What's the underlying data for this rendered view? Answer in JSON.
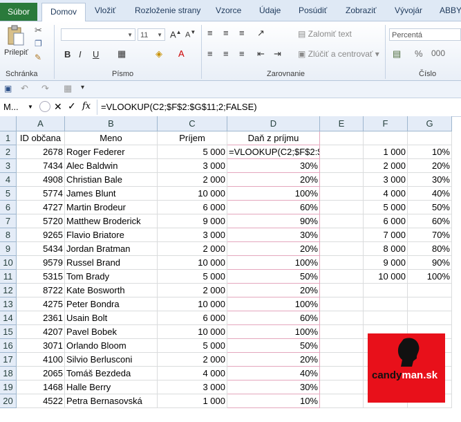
{
  "ribbon": {
    "tabs": [
      "Súbor",
      "Domov",
      "Vložiť",
      "Rozloženie strany",
      "Vzorce",
      "Údaje",
      "Posúdiť",
      "Zobraziť",
      "Vývojár",
      "ABBY"
    ],
    "groups": {
      "clipboard": "Schránka",
      "font": "Písmo",
      "alignment": "Zarovnanie",
      "number": "Číslo"
    },
    "paste_label": "Prilepiť",
    "font_name": "",
    "font_size": "11",
    "wrap_text": "Zalomiť text",
    "merge_center": "Zlúčiť a centrovať",
    "number_format": "Percentá",
    "bold": "B",
    "italic": "I",
    "underline": "U"
  },
  "formula_bar": {
    "name_box": "M...",
    "fx": "fx",
    "formula": "=VLOOKUP(C2;$F$2:$G$11;2;FALSE)"
  },
  "columns": [
    "A",
    "B",
    "C",
    "D",
    "E",
    "F",
    "G"
  ],
  "headers": {
    "A": "ID občana",
    "B": "Meno",
    "C": "Príjem",
    "D": "Daň z príjmu"
  },
  "rows": [
    {
      "id": "2678",
      "name": "Roger Federer",
      "income": "5 000",
      "tax": "=VLOOKUP(C2;$F$2:$"
    },
    {
      "id": "7434",
      "name": "Alec Baldwin",
      "income": "3 000",
      "tax": "30%"
    },
    {
      "id": "4908",
      "name": "Christian Bale",
      "income": "2 000",
      "tax": "20%"
    },
    {
      "id": "5774",
      "name": "James Blunt",
      "income": "10 000",
      "tax": "100%"
    },
    {
      "id": "4727",
      "name": "Martin Brodeur",
      "income": "6 000",
      "tax": "60%"
    },
    {
      "id": "5720",
      "name": "Matthew Broderick",
      "income": "9 000",
      "tax": "90%"
    },
    {
      "id": "9265",
      "name": "Flavio Briatore",
      "income": "3 000",
      "tax": "30%"
    },
    {
      "id": "5434",
      "name": "Jordan Bratman",
      "income": "2 000",
      "tax": "20%"
    },
    {
      "id": "9579",
      "name": "Russel Brand",
      "income": "10 000",
      "tax": "100%"
    },
    {
      "id": "5315",
      "name": "Tom Brady",
      "income": "5 000",
      "tax": "50%"
    },
    {
      "id": "8722",
      "name": "Kate Bosworth",
      "income": "2 000",
      "tax": "20%"
    },
    {
      "id": "4275",
      "name": "Peter Bondra",
      "income": "10 000",
      "tax": "100%"
    },
    {
      "id": "2361",
      "name": "Usain Bolt",
      "income": "6 000",
      "tax": "60%"
    },
    {
      "id": "4207",
      "name": "Pavel Bobek",
      "income": "10 000",
      "tax": "100%"
    },
    {
      "id": "3071",
      "name": "Orlando Bloom",
      "income": "5 000",
      "tax": "50%"
    },
    {
      "id": "4100",
      "name": "Silvio Berlusconi",
      "income": "2 000",
      "tax": "20%"
    },
    {
      "id": "2065",
      "name": "Tomáš Bezdeda",
      "income": "4 000",
      "tax": "40%"
    },
    {
      "id": "1468",
      "name": "Halle Berry",
      "income": "3 000",
      "tax": "30%"
    },
    {
      "id": "4522",
      "name": "Petra Bernasovská",
      "income": "1 000",
      "tax": "10%"
    }
  ],
  "lookup": [
    {
      "f": "1 000",
      "g": "10%"
    },
    {
      "f": "2 000",
      "g": "20%"
    },
    {
      "f": "3 000",
      "g": "30%"
    },
    {
      "f": "4 000",
      "g": "40%"
    },
    {
      "f": "5 000",
      "g": "50%"
    },
    {
      "f": "6 000",
      "g": "60%"
    },
    {
      "f": "7 000",
      "g": "70%"
    },
    {
      "f": "8 000",
      "g": "80%"
    },
    {
      "f": "9 000",
      "g": "90%"
    },
    {
      "f": "10 000",
      "g": "100%"
    }
  ],
  "logo": {
    "text_a": "candy",
    "text_b": "man.sk"
  },
  "colors": {
    "file_tab": "#2a7a3b",
    "logo_bg": "#e8101a",
    "pink_border": "#e4a6bd",
    "header_bg": "#e4ecf7"
  }
}
